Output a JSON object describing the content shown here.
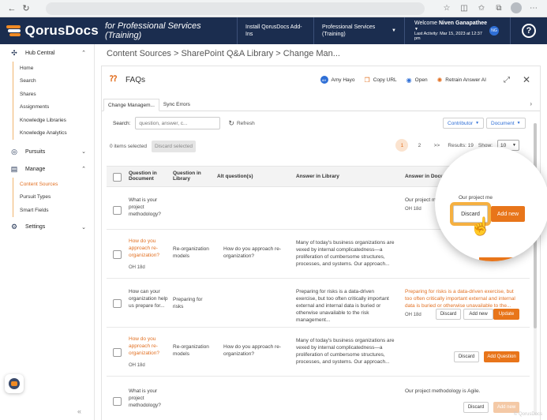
{
  "browser": {
    "back": "←",
    "reload": "↻"
  },
  "header": {
    "logo": "QorusDocs",
    "subtitle": "for Professional Services (Training)",
    "install_link": "Install QorusDocs Add-Ins",
    "workspace": "Professional Services (Training)",
    "welcome_prefix": "Welcome ",
    "user_name": "Niven Ganapathee",
    "last_activity": "Last Activity: Mar 15, 2023 at 12:37 pm",
    "user_initials": "NG",
    "help": "?"
  },
  "sidebar": {
    "hub_central": "Hub Central",
    "hub_items": [
      "Home",
      "Search",
      "Shares",
      "Assignments",
      "Knowledge Libraries",
      "Knowledge Analytics"
    ],
    "pursuits": "Pursuits",
    "manage": "Manage",
    "manage_items": [
      "Content Sources",
      "Pursuit Types",
      "Smart Fields"
    ],
    "settings": "Settings"
  },
  "breadcrumb": "Content Sources > SharePoint Q&A Library > Change Man...",
  "panel": {
    "title": "FAQs",
    "assignee_initials": "AH",
    "assignee": "Amy Hayo",
    "copy_url": "Copy URL",
    "open": "Open",
    "retrain": "Retrain Answer AI",
    "tabs": [
      "Change Managem...",
      "Sync Errors"
    ]
  },
  "filters": {
    "search_label": "Search:",
    "search_placeholder": "question, answer, c...",
    "refresh": "Refresh",
    "contributor": "Contributor",
    "document": "Document"
  },
  "selection": {
    "selected_text": "0 items selected",
    "discard_selected": "Discard selected",
    "pages": [
      "1",
      "2",
      ">>"
    ],
    "results": "Results: 19",
    "show_label": "Show:",
    "show_value": "10"
  },
  "table": {
    "headers": [
      "Question in Document",
      "Question in Library",
      "Alt question(s)",
      "Answer in Library",
      "Answer in Document"
    ],
    "rows": [
      {
        "q_doc": "What is your project methodology?",
        "q_lib": "",
        "alt": "",
        "a_lib": "",
        "a_doc": "Our project methodology is Agile.",
        "meta": "OH 18d"
      },
      {
        "q_doc": "How do you approach re-organization?",
        "meta": "OH 18d",
        "q_lib": "Re-organization models",
        "alt": "How do you approach re-organization?",
        "a_lib": "Many of today's business organizations are vexed by internal complicatedness—a proliferation of cumbersome structures, processes, and systems. Our approach...",
        "a_doc": ""
      },
      {
        "q_doc": "How can your organization help us prepare for...",
        "q_lib": "Preparing for risks",
        "alt": "",
        "a_lib": "Preparing for risks is a data-driven exercise, but too often critically important external and internal data is buried or otherwise unavailable to the risk management...",
        "a_doc": "Preparing for risks is a data-driven exercise, but too often critically important external and internal data is buried or otherwise unavailable to the...",
        "meta": "OH 18d"
      },
      {
        "q_doc": "How do you approach re-organization?",
        "meta": "OH 18d",
        "q_lib": "Re-organization models",
        "alt": "How do you approach re-organization?",
        "a_lib": "Many of today's business organizations are vexed by internal complicatedness—a proliferation of cumbersome structures, processes, and systems. Our approach...",
        "a_doc": ""
      },
      {
        "q_doc": "What is your project methodology?",
        "q_lib": "",
        "alt": "",
        "a_lib": "",
        "a_doc": "Our project methodology is Agile.",
        "meta": ""
      }
    ],
    "btn_discard": "Discard",
    "btn_add_new": "Add new",
    "btn_update": "Update",
    "btn_add_question": "Add Question"
  },
  "callout": {
    "snippet": "Our project me",
    "discard": "Discard",
    "add_new": "Add new"
  },
  "watermark": "© QorusDocs",
  "collapse": "«"
}
